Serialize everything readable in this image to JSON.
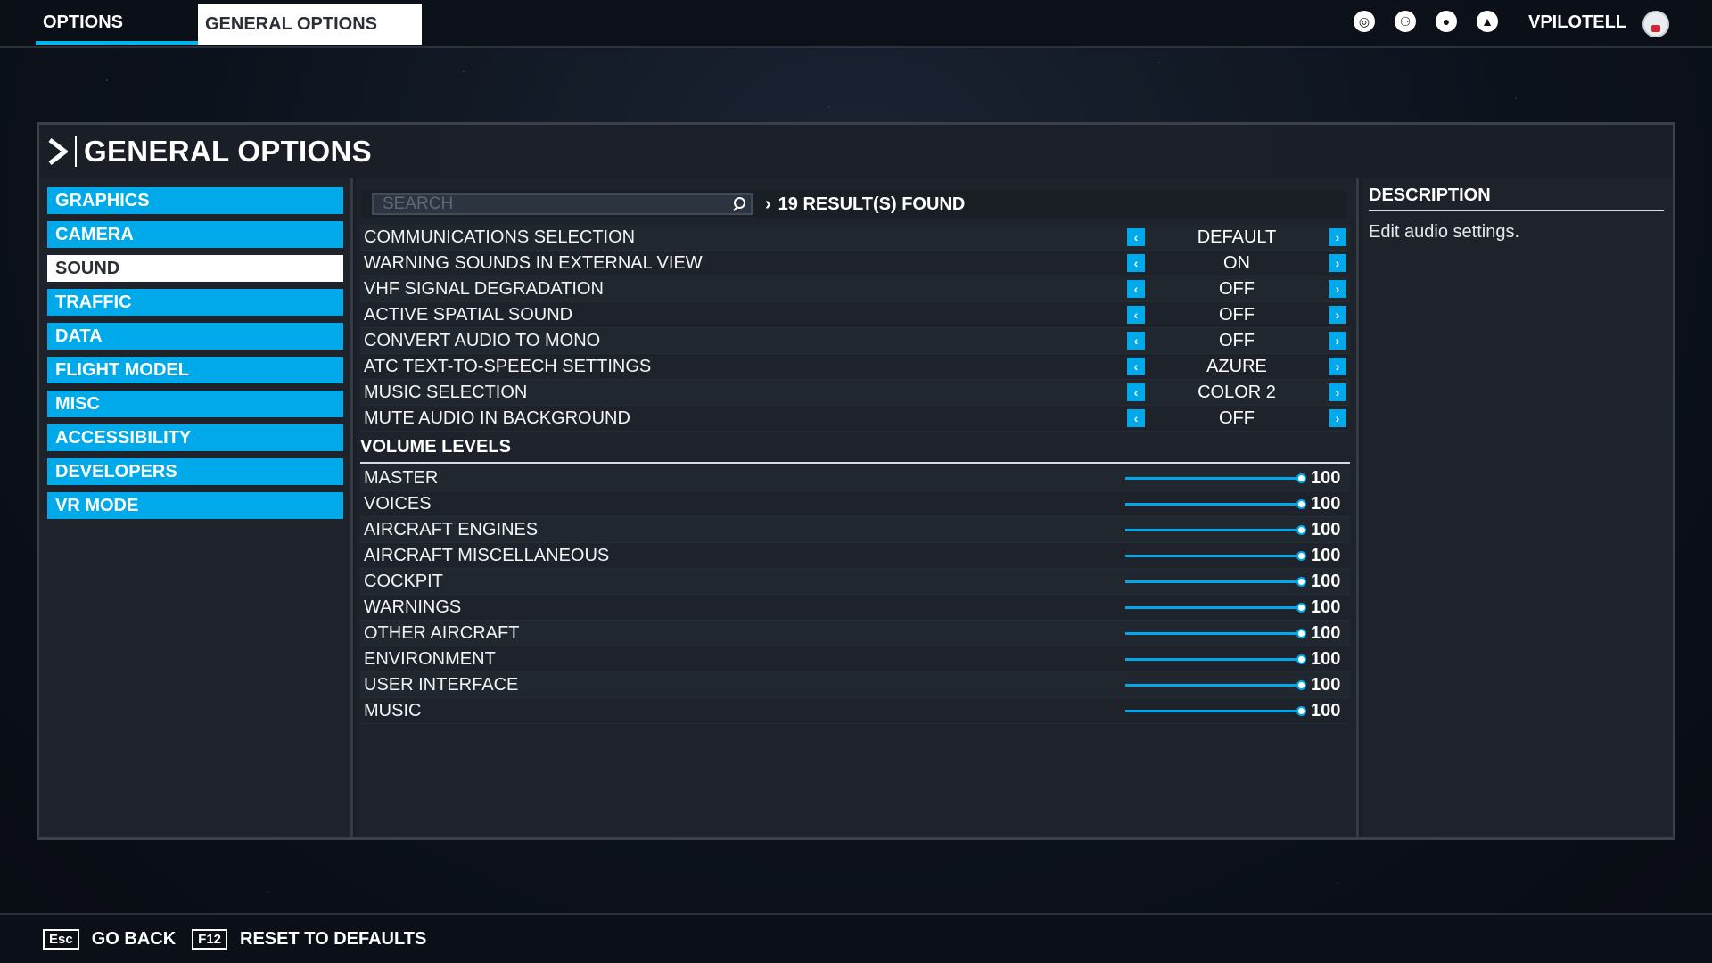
{
  "topbar": {
    "tabs": [
      {
        "label": "OPTIONS"
      },
      {
        "label": "GENERAL OPTIONS"
      }
    ],
    "icons": [
      "activity-icon",
      "friends-icon",
      "profile-icon",
      "notifications-icon"
    ],
    "username": "VPILOTELL"
  },
  "panel": {
    "title": "GENERAL OPTIONS",
    "categories": [
      {
        "label": "GRAPHICS"
      },
      {
        "label": "CAMERA"
      },
      {
        "label": "SOUND"
      },
      {
        "label": "TRAFFIC"
      },
      {
        "label": "DATA"
      },
      {
        "label": "FLIGHT MODEL"
      },
      {
        "label": "MISC"
      },
      {
        "label": "ACCESSIBILITY"
      },
      {
        "label": "DEVELOPERS"
      },
      {
        "label": "VR MODE"
      }
    ],
    "active_category": "SOUND",
    "search": {
      "placeholder": "SEARCH",
      "value": ""
    },
    "results_text": "19 RESULT(S) FOUND",
    "settings": [
      {
        "label": "COMMUNICATIONS SELECTION",
        "value": "DEFAULT"
      },
      {
        "label": "WARNING SOUNDS IN EXTERNAL VIEW",
        "value": "ON"
      },
      {
        "label": "VHF SIGNAL DEGRADATION",
        "value": "OFF"
      },
      {
        "label": "ACTIVE SPATIAL SOUND",
        "value": "OFF"
      },
      {
        "label": "CONVERT AUDIO TO MONO",
        "value": "OFF"
      },
      {
        "label": "ATC TEXT-TO-SPEECH SETTINGS",
        "value": "AZURE"
      },
      {
        "label": "MUSIC SELECTION",
        "value": "COLOR 2"
      },
      {
        "label": "MUTE AUDIO IN BACKGROUND",
        "value": "OFF"
      }
    ],
    "volume_title": "VOLUME LEVELS",
    "volumes": [
      {
        "label": "MASTER",
        "value": "100"
      },
      {
        "label": "VOICES",
        "value": "100"
      },
      {
        "label": "AIRCRAFT ENGINES",
        "value": "100"
      },
      {
        "label": "AIRCRAFT MISCELLANEOUS",
        "value": "100"
      },
      {
        "label": "COCKPIT",
        "value": "100"
      },
      {
        "label": "WARNINGS",
        "value": "100"
      },
      {
        "label": "OTHER AIRCRAFT",
        "value": "100"
      },
      {
        "label": "ENVIRONMENT",
        "value": "100"
      },
      {
        "label": "USER INTERFACE",
        "value": "100"
      },
      {
        "label": "MUSIC",
        "value": "100"
      }
    ],
    "description": {
      "title": "DESCRIPTION",
      "text": "Edit audio settings."
    }
  },
  "bottombar": {
    "actions": [
      {
        "key": "Esc",
        "label": "GO BACK"
      },
      {
        "key": "F12",
        "label": "RESET TO DEFAULTS"
      }
    ]
  },
  "colors": {
    "accent": "#00a9ea",
    "panel": "#1e232b",
    "text": "#ffffff"
  }
}
